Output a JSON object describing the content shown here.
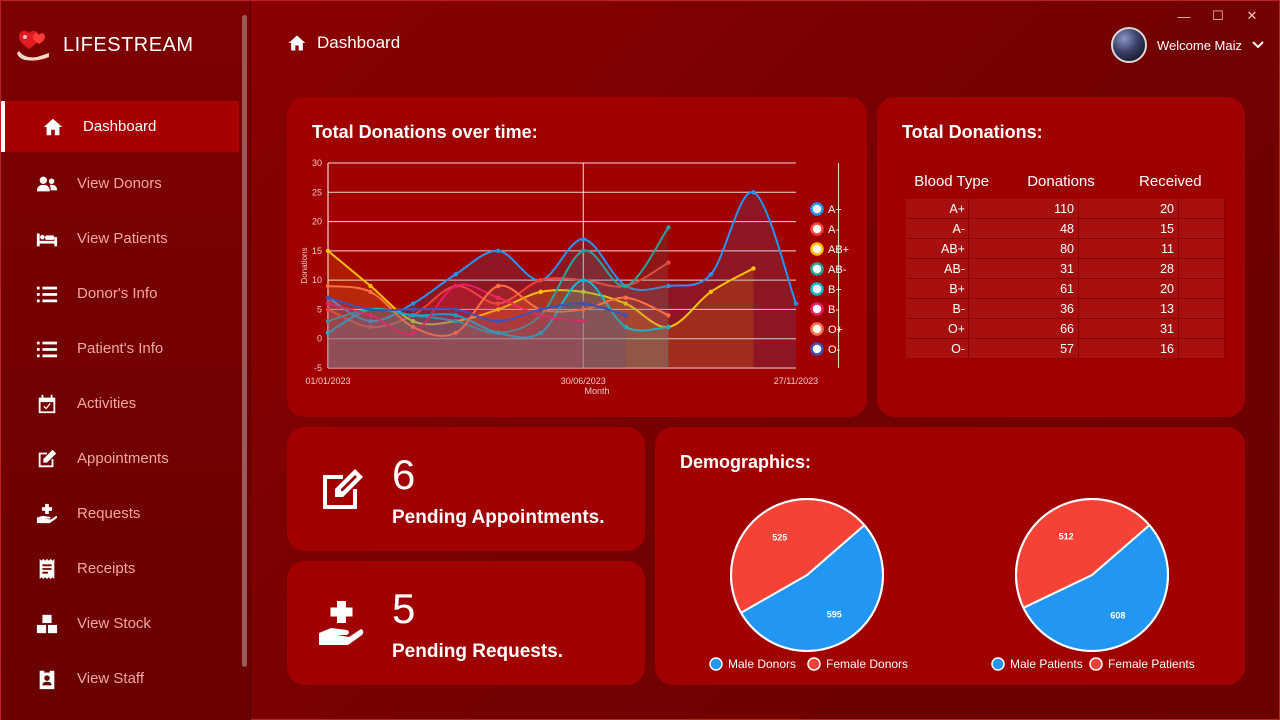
{
  "app": {
    "name": "LIFESTREAM"
  },
  "window_controls": {
    "minimize": "—",
    "maximize": "☐",
    "close": "✕"
  },
  "header": {
    "title": "Dashboard",
    "welcome": "Welcome Maiz"
  },
  "sidebar": {
    "items": [
      {
        "label": "Dashboard",
        "icon": "home-icon",
        "active": true
      },
      {
        "label": "View Donors",
        "icon": "users-icon"
      },
      {
        "label": "View Patients",
        "icon": "bed-icon"
      },
      {
        "label": "Donor's Info",
        "icon": "list-icon"
      },
      {
        "label": "Patient's Info",
        "icon": "list-icon"
      },
      {
        "label": "Activities",
        "icon": "calendar-check-icon"
      },
      {
        "label": "Appointments",
        "icon": "edit-icon"
      },
      {
        "label": "Requests",
        "icon": "hand-medical-icon"
      },
      {
        "label": "Receipts",
        "icon": "receipt-icon"
      },
      {
        "label": "View Stock",
        "icon": "boxes-icon"
      },
      {
        "label": "View Staff",
        "icon": "id-badge-icon"
      }
    ]
  },
  "donations_chart": {
    "title": "Total Donations over time:",
    "chart_data": {
      "type": "line",
      "xlabel": "Month",
      "ylabel": "Donations",
      "ylim": [
        -5,
        30
      ],
      "yticks": [
        -5,
        0,
        5,
        10,
        15,
        20,
        25,
        30
      ],
      "xtick_labels": [
        "01/01/2023",
        "30/06/2023",
        "27/11/2023"
      ],
      "x": [
        "01/01/2023",
        "1",
        "2",
        "3",
        "4",
        "5",
        "30/06/2023",
        "7",
        "8",
        "9",
        "10",
        "27/11/2023",
        "12"
      ],
      "grid": true,
      "legend": "right",
      "series": [
        {
          "name": "A+",
          "color": "#2196F3",
          "values": [
            7,
            3,
            6,
            11,
            15,
            10,
            17,
            9,
            9,
            11,
            25,
            6
          ]
        },
        {
          "name": "A-",
          "color": "#F44336",
          "values": [
            5,
            2,
            4,
            9,
            6,
            10,
            10,
            9,
            13
          ]
        },
        {
          "name": "AB+",
          "color": "#FFC107",
          "values": [
            15,
            9,
            3,
            3,
            5,
            8,
            8,
            6,
            2,
            8,
            12
          ]
        },
        {
          "name": "AB-",
          "color": "#26A69A",
          "values": [
            3,
            5,
            4,
            3,
            1,
            4,
            15,
            9,
            19
          ]
        },
        {
          "name": "B+",
          "color": "#00BCD4",
          "values": [
            1,
            5,
            4,
            4,
            1,
            1,
            10,
            2,
            2
          ]
        },
        {
          "name": "B-",
          "color": "#E91E63",
          "values": [
            6,
            4,
            1,
            9,
            7,
            4,
            3
          ]
        },
        {
          "name": "O+",
          "color": "#FF7043",
          "values": [
            9,
            8,
            2,
            1,
            9,
            5,
            5,
            7,
            4
          ]
        },
        {
          "name": "O-",
          "color": "#3F51B5",
          "values": [
            7,
            5,
            5,
            5,
            3,
            5,
            6,
            4
          ]
        }
      ]
    }
  },
  "totals": {
    "title": "Total Donations:",
    "columns": [
      "Blood Type",
      "Donations",
      "Received"
    ],
    "rows": [
      [
        "A+",
        "110",
        "20"
      ],
      [
        "A-",
        "48",
        "15"
      ],
      [
        "AB+",
        "80",
        "11"
      ],
      [
        "AB-",
        "31",
        "28"
      ],
      [
        "B+",
        "61",
        "20"
      ],
      [
        "B-",
        "36",
        "13"
      ],
      [
        "O+",
        "66",
        "31"
      ],
      [
        "O-",
        "57",
        "16"
      ]
    ]
  },
  "pending_appointments": {
    "count": "6",
    "label": "Pending Appointments."
  },
  "pending_requests": {
    "count": "5",
    "label": "Pending Requests."
  },
  "demographics": {
    "title": "Demographics:",
    "chart_data": [
      {
        "type": "pie",
        "slices": [
          {
            "name": "Male Donors",
            "value": 595,
            "color": "#2196F3"
          },
          {
            "name": "Female Donors",
            "value": 525,
            "color": "#F44336"
          }
        ]
      },
      {
        "type": "pie",
        "slices": [
          {
            "name": "Male Patients",
            "value": 608,
            "color": "#2196F3"
          },
          {
            "name": "Female Patients",
            "value": 512,
            "color": "#F44336"
          }
        ]
      }
    ]
  }
}
